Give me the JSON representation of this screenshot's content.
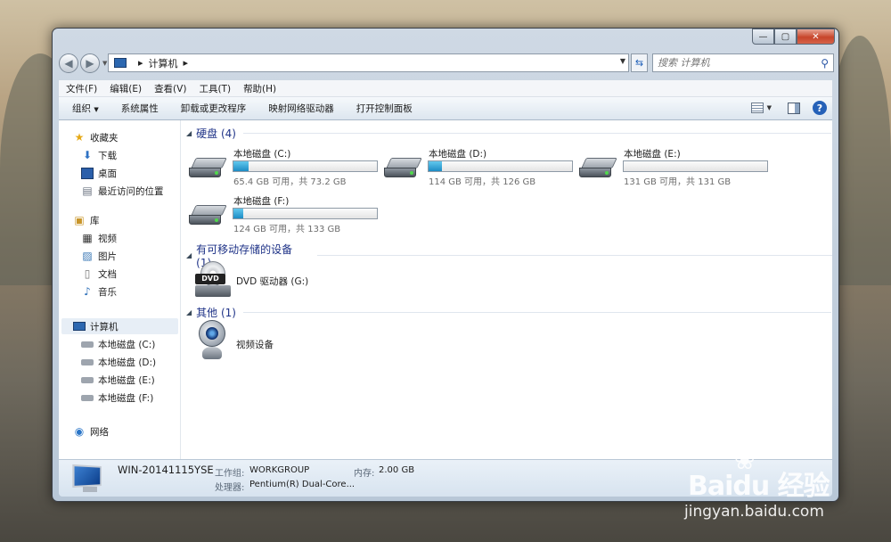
{
  "address": {
    "root_label": "计算机"
  },
  "search": {
    "placeholder": "搜索 计算机"
  },
  "menubar": [
    "文件(F)",
    "编辑(E)",
    "查看(V)",
    "工具(T)",
    "帮助(H)"
  ],
  "toolbar": {
    "organize": "组织",
    "system_properties": "系统属性",
    "uninstall": "卸载或更改程序",
    "map_drive": "映射网络驱动器",
    "control_panel": "打开控制面板"
  },
  "sidebar": {
    "favorites": {
      "label": "收藏夹",
      "items": [
        "下载",
        "桌面",
        "最近访问的位置"
      ]
    },
    "libraries": {
      "label": "库",
      "items": [
        "视频",
        "图片",
        "文档",
        "音乐"
      ]
    },
    "computer": {
      "label": "计算机",
      "items": [
        "本地磁盘 (C:)",
        "本地磁盘 (D:)",
        "本地磁盘 (E:)",
        "本地磁盘 (F:)"
      ]
    },
    "network": {
      "label": "网络"
    }
  },
  "groups": {
    "hdd": {
      "title": "硬盘 (4)"
    },
    "removable": {
      "title": "有可移动存储的设备 (1)"
    },
    "other": {
      "title": "其他 (1)"
    }
  },
  "drives": [
    {
      "name": "本地磁盘 (C:)",
      "free_text": "65.4 GB 可用，共 73.2 GB",
      "used_fraction": 0.107
    },
    {
      "name": "本地磁盘 (D:)",
      "free_text": "114 GB 可用，共 126 GB",
      "used_fraction": 0.095
    },
    {
      "name": "本地磁盘 (E:)",
      "free_text": "131 GB 可用，共 131 GB",
      "used_fraction": 0.0
    },
    {
      "name": "本地磁盘 (F:)",
      "free_text": "124 GB 可用，共 133 GB",
      "used_fraction": 0.068
    }
  ],
  "dvd": {
    "name": "DVD 驱动器 (G:)",
    "badge": "DVD"
  },
  "other_device": {
    "name": "视频设备"
  },
  "details": {
    "computer_name": "WIN-20141115YSE",
    "workgroup_key": "工作组:",
    "workgroup_val": "WORKGROUP",
    "memory_key": "内存:",
    "memory_val": "2.00 GB",
    "cpu_key": "处理器:",
    "cpu_val": "Pentium(R) Dual-Core..."
  },
  "watermark": {
    "brand": "Baidu 经验",
    "url": "jingyan.baidu.com"
  }
}
